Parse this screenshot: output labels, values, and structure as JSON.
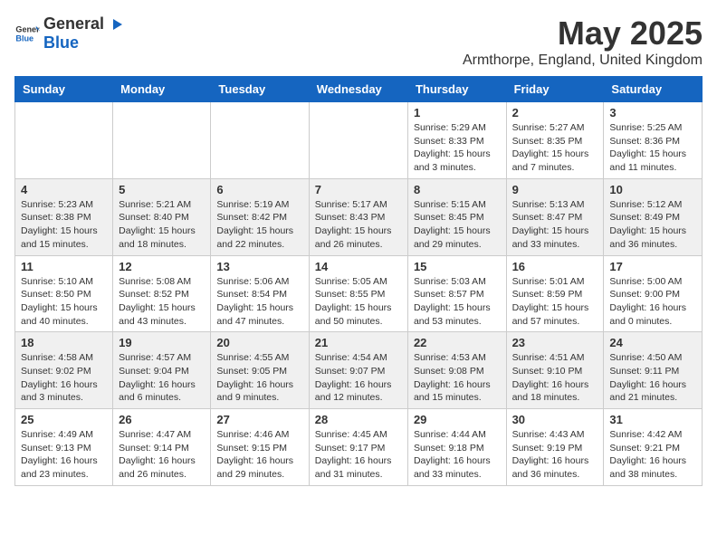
{
  "header": {
    "logo_general": "General",
    "logo_blue": "Blue",
    "month_year": "May 2025",
    "location": "Armthorpe, England, United Kingdom"
  },
  "days_of_week": [
    "Sunday",
    "Monday",
    "Tuesday",
    "Wednesday",
    "Thursday",
    "Friday",
    "Saturday"
  ],
  "weeks": [
    [
      {
        "day": "",
        "text": ""
      },
      {
        "day": "",
        "text": ""
      },
      {
        "day": "",
        "text": ""
      },
      {
        "day": "",
        "text": ""
      },
      {
        "day": "1",
        "text": "Sunrise: 5:29 AM\nSunset: 8:33 PM\nDaylight: 15 hours\nand 3 minutes."
      },
      {
        "day": "2",
        "text": "Sunrise: 5:27 AM\nSunset: 8:35 PM\nDaylight: 15 hours\nand 7 minutes."
      },
      {
        "day": "3",
        "text": "Sunrise: 5:25 AM\nSunset: 8:36 PM\nDaylight: 15 hours\nand 11 minutes."
      }
    ],
    [
      {
        "day": "4",
        "text": "Sunrise: 5:23 AM\nSunset: 8:38 PM\nDaylight: 15 hours\nand 15 minutes."
      },
      {
        "day": "5",
        "text": "Sunrise: 5:21 AM\nSunset: 8:40 PM\nDaylight: 15 hours\nand 18 minutes."
      },
      {
        "day": "6",
        "text": "Sunrise: 5:19 AM\nSunset: 8:42 PM\nDaylight: 15 hours\nand 22 minutes."
      },
      {
        "day": "7",
        "text": "Sunrise: 5:17 AM\nSunset: 8:43 PM\nDaylight: 15 hours\nand 26 minutes."
      },
      {
        "day": "8",
        "text": "Sunrise: 5:15 AM\nSunset: 8:45 PM\nDaylight: 15 hours\nand 29 minutes."
      },
      {
        "day": "9",
        "text": "Sunrise: 5:13 AM\nSunset: 8:47 PM\nDaylight: 15 hours\nand 33 minutes."
      },
      {
        "day": "10",
        "text": "Sunrise: 5:12 AM\nSunset: 8:49 PM\nDaylight: 15 hours\nand 36 minutes."
      }
    ],
    [
      {
        "day": "11",
        "text": "Sunrise: 5:10 AM\nSunset: 8:50 PM\nDaylight: 15 hours\nand 40 minutes."
      },
      {
        "day": "12",
        "text": "Sunrise: 5:08 AM\nSunset: 8:52 PM\nDaylight: 15 hours\nand 43 minutes."
      },
      {
        "day": "13",
        "text": "Sunrise: 5:06 AM\nSunset: 8:54 PM\nDaylight: 15 hours\nand 47 minutes."
      },
      {
        "day": "14",
        "text": "Sunrise: 5:05 AM\nSunset: 8:55 PM\nDaylight: 15 hours\nand 50 minutes."
      },
      {
        "day": "15",
        "text": "Sunrise: 5:03 AM\nSunset: 8:57 PM\nDaylight: 15 hours\nand 53 minutes."
      },
      {
        "day": "16",
        "text": "Sunrise: 5:01 AM\nSunset: 8:59 PM\nDaylight: 15 hours\nand 57 minutes."
      },
      {
        "day": "17",
        "text": "Sunrise: 5:00 AM\nSunset: 9:00 PM\nDaylight: 16 hours\nand 0 minutes."
      }
    ],
    [
      {
        "day": "18",
        "text": "Sunrise: 4:58 AM\nSunset: 9:02 PM\nDaylight: 16 hours\nand 3 minutes."
      },
      {
        "day": "19",
        "text": "Sunrise: 4:57 AM\nSunset: 9:04 PM\nDaylight: 16 hours\nand 6 minutes."
      },
      {
        "day": "20",
        "text": "Sunrise: 4:55 AM\nSunset: 9:05 PM\nDaylight: 16 hours\nand 9 minutes."
      },
      {
        "day": "21",
        "text": "Sunrise: 4:54 AM\nSunset: 9:07 PM\nDaylight: 16 hours\nand 12 minutes."
      },
      {
        "day": "22",
        "text": "Sunrise: 4:53 AM\nSunset: 9:08 PM\nDaylight: 16 hours\nand 15 minutes."
      },
      {
        "day": "23",
        "text": "Sunrise: 4:51 AM\nSunset: 9:10 PM\nDaylight: 16 hours\nand 18 minutes."
      },
      {
        "day": "24",
        "text": "Sunrise: 4:50 AM\nSunset: 9:11 PM\nDaylight: 16 hours\nand 21 minutes."
      }
    ],
    [
      {
        "day": "25",
        "text": "Sunrise: 4:49 AM\nSunset: 9:13 PM\nDaylight: 16 hours\nand 23 minutes."
      },
      {
        "day": "26",
        "text": "Sunrise: 4:47 AM\nSunset: 9:14 PM\nDaylight: 16 hours\nand 26 minutes."
      },
      {
        "day": "27",
        "text": "Sunrise: 4:46 AM\nSunset: 9:15 PM\nDaylight: 16 hours\nand 29 minutes."
      },
      {
        "day": "28",
        "text": "Sunrise: 4:45 AM\nSunset: 9:17 PM\nDaylight: 16 hours\nand 31 minutes."
      },
      {
        "day": "29",
        "text": "Sunrise: 4:44 AM\nSunset: 9:18 PM\nDaylight: 16 hours\nand 33 minutes."
      },
      {
        "day": "30",
        "text": "Sunrise: 4:43 AM\nSunset: 9:19 PM\nDaylight: 16 hours\nand 36 minutes."
      },
      {
        "day": "31",
        "text": "Sunrise: 4:42 AM\nSunset: 9:21 PM\nDaylight: 16 hours\nand 38 minutes."
      }
    ]
  ]
}
